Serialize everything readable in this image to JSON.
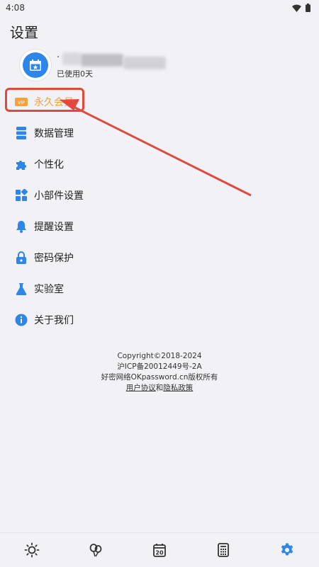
{
  "status_bar": {
    "time": "4:08"
  },
  "page": {
    "title": "设置"
  },
  "profile": {
    "name": "·",
    "subtitle": "已使用0天"
  },
  "menu": [
    {
      "label": "永久会员",
      "icon": "vip-icon"
    },
    {
      "label": "数据管理",
      "icon": "database-icon"
    },
    {
      "label": "个性化",
      "icon": "puzzle-icon"
    },
    {
      "label": "小部件设置",
      "icon": "widgets-icon"
    },
    {
      "label": "提醒设置",
      "icon": "bell-icon"
    },
    {
      "label": "密码保护",
      "icon": "lock-icon"
    },
    {
      "label": "实验室",
      "icon": "flask-icon"
    },
    {
      "label": "关于我们",
      "icon": "info-icon"
    }
  ],
  "footer": {
    "copyright": "Copyright©2018-2024",
    "icp": "沪ICP备20012449号-2A",
    "owner": "好密网络OKpassword.cn版权所有",
    "agreement": "用户协议",
    "and": "和",
    "privacy": "隐私政策"
  },
  "bottom_nav": [
    {
      "name": "sun-icon"
    },
    {
      "name": "balloons-icon"
    },
    {
      "name": "calendar-icon",
      "badge": "20"
    },
    {
      "name": "calculator-icon"
    },
    {
      "name": "settings-gear-icon",
      "active": true
    }
  ],
  "colors": {
    "accent": "#2f86e9",
    "vip": "#f2a340",
    "highlight": "#e3493a"
  }
}
